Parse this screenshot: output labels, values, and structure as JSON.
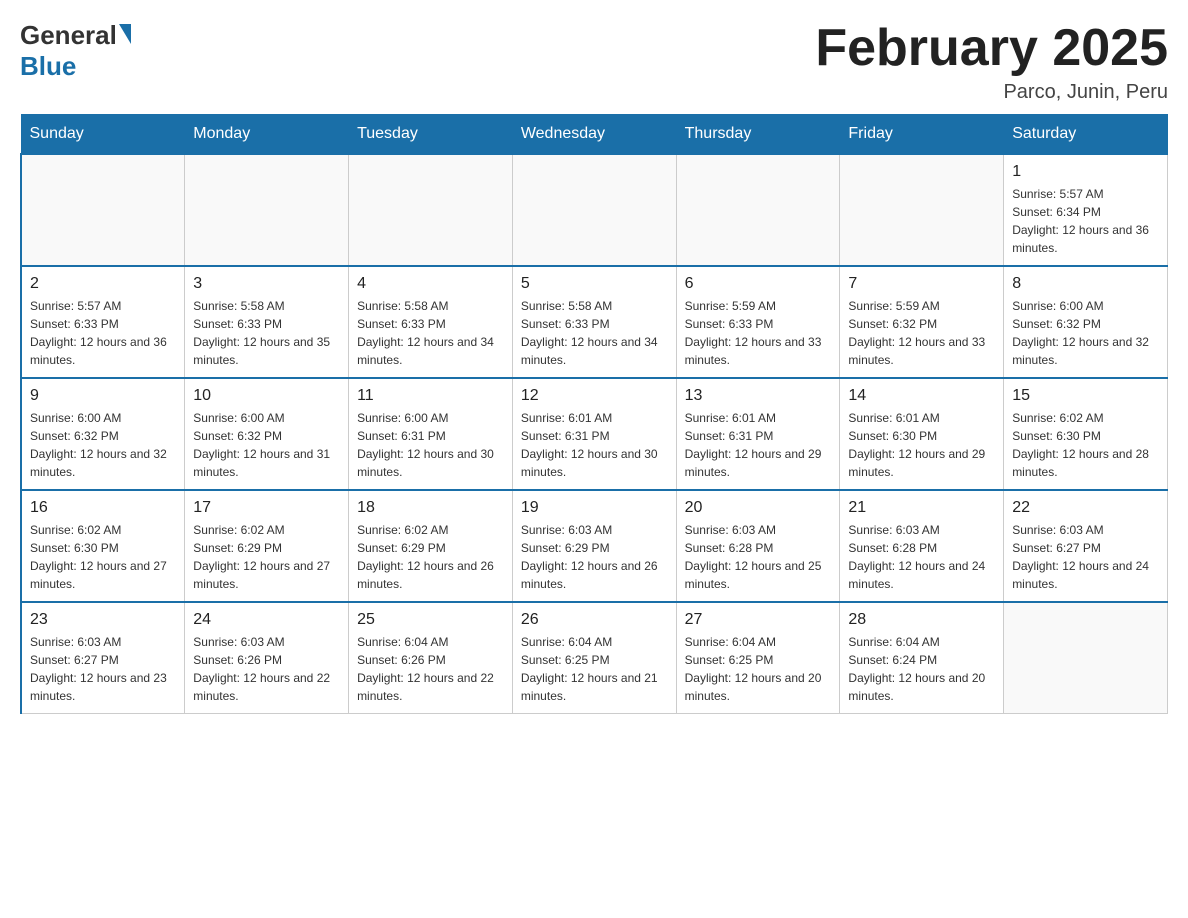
{
  "logo": {
    "general": "General",
    "blue": "Blue"
  },
  "title": "February 2025",
  "location": "Parco, Junin, Peru",
  "days_of_week": [
    "Sunday",
    "Monday",
    "Tuesday",
    "Wednesday",
    "Thursday",
    "Friday",
    "Saturday"
  ],
  "weeks": [
    [
      {
        "day": "",
        "info": ""
      },
      {
        "day": "",
        "info": ""
      },
      {
        "day": "",
        "info": ""
      },
      {
        "day": "",
        "info": ""
      },
      {
        "day": "",
        "info": ""
      },
      {
        "day": "",
        "info": ""
      },
      {
        "day": "1",
        "info": "Sunrise: 5:57 AM\nSunset: 6:34 PM\nDaylight: 12 hours and 36 minutes."
      }
    ],
    [
      {
        "day": "2",
        "info": "Sunrise: 5:57 AM\nSunset: 6:33 PM\nDaylight: 12 hours and 36 minutes."
      },
      {
        "day": "3",
        "info": "Sunrise: 5:58 AM\nSunset: 6:33 PM\nDaylight: 12 hours and 35 minutes."
      },
      {
        "day": "4",
        "info": "Sunrise: 5:58 AM\nSunset: 6:33 PM\nDaylight: 12 hours and 34 minutes."
      },
      {
        "day": "5",
        "info": "Sunrise: 5:58 AM\nSunset: 6:33 PM\nDaylight: 12 hours and 34 minutes."
      },
      {
        "day": "6",
        "info": "Sunrise: 5:59 AM\nSunset: 6:33 PM\nDaylight: 12 hours and 33 minutes."
      },
      {
        "day": "7",
        "info": "Sunrise: 5:59 AM\nSunset: 6:32 PM\nDaylight: 12 hours and 33 minutes."
      },
      {
        "day": "8",
        "info": "Sunrise: 6:00 AM\nSunset: 6:32 PM\nDaylight: 12 hours and 32 minutes."
      }
    ],
    [
      {
        "day": "9",
        "info": "Sunrise: 6:00 AM\nSunset: 6:32 PM\nDaylight: 12 hours and 32 minutes."
      },
      {
        "day": "10",
        "info": "Sunrise: 6:00 AM\nSunset: 6:32 PM\nDaylight: 12 hours and 31 minutes."
      },
      {
        "day": "11",
        "info": "Sunrise: 6:00 AM\nSunset: 6:31 PM\nDaylight: 12 hours and 30 minutes."
      },
      {
        "day": "12",
        "info": "Sunrise: 6:01 AM\nSunset: 6:31 PM\nDaylight: 12 hours and 30 minutes."
      },
      {
        "day": "13",
        "info": "Sunrise: 6:01 AM\nSunset: 6:31 PM\nDaylight: 12 hours and 29 minutes."
      },
      {
        "day": "14",
        "info": "Sunrise: 6:01 AM\nSunset: 6:30 PM\nDaylight: 12 hours and 29 minutes."
      },
      {
        "day": "15",
        "info": "Sunrise: 6:02 AM\nSunset: 6:30 PM\nDaylight: 12 hours and 28 minutes."
      }
    ],
    [
      {
        "day": "16",
        "info": "Sunrise: 6:02 AM\nSunset: 6:30 PM\nDaylight: 12 hours and 27 minutes."
      },
      {
        "day": "17",
        "info": "Sunrise: 6:02 AM\nSunset: 6:29 PM\nDaylight: 12 hours and 27 minutes."
      },
      {
        "day": "18",
        "info": "Sunrise: 6:02 AM\nSunset: 6:29 PM\nDaylight: 12 hours and 26 minutes."
      },
      {
        "day": "19",
        "info": "Sunrise: 6:03 AM\nSunset: 6:29 PM\nDaylight: 12 hours and 26 minutes."
      },
      {
        "day": "20",
        "info": "Sunrise: 6:03 AM\nSunset: 6:28 PM\nDaylight: 12 hours and 25 minutes."
      },
      {
        "day": "21",
        "info": "Sunrise: 6:03 AM\nSunset: 6:28 PM\nDaylight: 12 hours and 24 minutes."
      },
      {
        "day": "22",
        "info": "Sunrise: 6:03 AM\nSunset: 6:27 PM\nDaylight: 12 hours and 24 minutes."
      }
    ],
    [
      {
        "day": "23",
        "info": "Sunrise: 6:03 AM\nSunset: 6:27 PM\nDaylight: 12 hours and 23 minutes."
      },
      {
        "day": "24",
        "info": "Sunrise: 6:03 AM\nSunset: 6:26 PM\nDaylight: 12 hours and 22 minutes."
      },
      {
        "day": "25",
        "info": "Sunrise: 6:04 AM\nSunset: 6:26 PM\nDaylight: 12 hours and 22 minutes."
      },
      {
        "day": "26",
        "info": "Sunrise: 6:04 AM\nSunset: 6:25 PM\nDaylight: 12 hours and 21 minutes."
      },
      {
        "day": "27",
        "info": "Sunrise: 6:04 AM\nSunset: 6:25 PM\nDaylight: 12 hours and 20 minutes."
      },
      {
        "day": "28",
        "info": "Sunrise: 6:04 AM\nSunset: 6:24 PM\nDaylight: 12 hours and 20 minutes."
      },
      {
        "day": "",
        "info": ""
      }
    ]
  ]
}
